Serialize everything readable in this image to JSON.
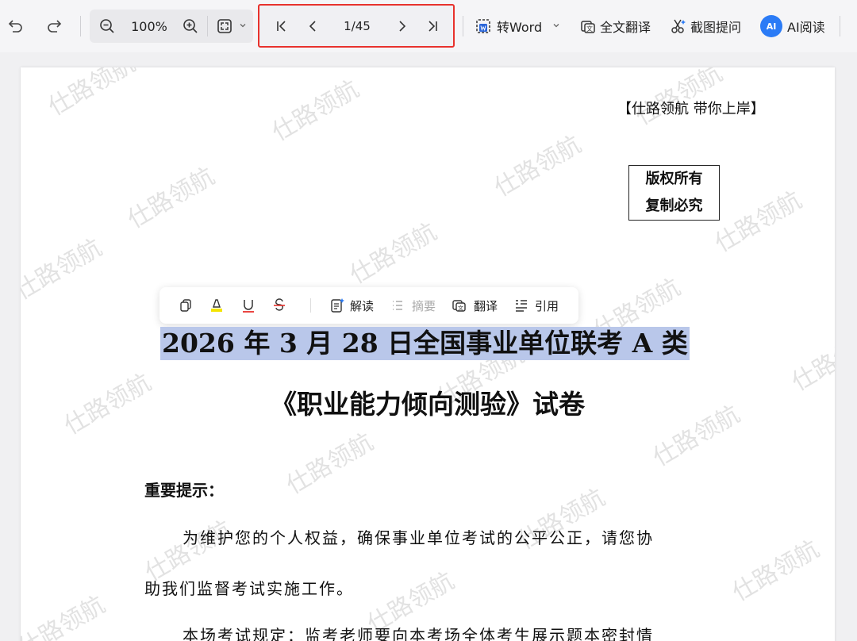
{
  "toolbar": {
    "zoom_level": "100%",
    "page_indicator": "1/45",
    "to_word_label": "转Word",
    "translate_all_label": "全文翻译",
    "screenshot_ask_label": "截图提问",
    "ai_read_label": "AI阅读",
    "ai_badge": "AI"
  },
  "document": {
    "header_note": "【仕路领航  带你上岸】",
    "copyright_line1": "版权所有",
    "copyright_line2": "复制必究",
    "title_line1": "2026 年 3 月 28 日全国事业单位联考 A 类",
    "title_line2": "《职业能力倾向测验》试卷",
    "section_title": "重要提示：",
    "para1_line1": "为维护您的个人权益，确保事业单位考试的公平公正，请您协",
    "para1_line2": "助我们监督考试实施工作。",
    "para2_line1": "本场考试规定：监考老师要向本考场全体考生展示题本密封情",
    "watermark": "仕路领航"
  },
  "selection_toolbar": {
    "explain_label": "解读",
    "summary_label": "摘要",
    "translate_label": "翻译",
    "cite_label": "引用"
  },
  "colors": {
    "accent": "#2b7bf6",
    "highlight": "#b9c7ea",
    "nav_border": "#e8322d"
  }
}
